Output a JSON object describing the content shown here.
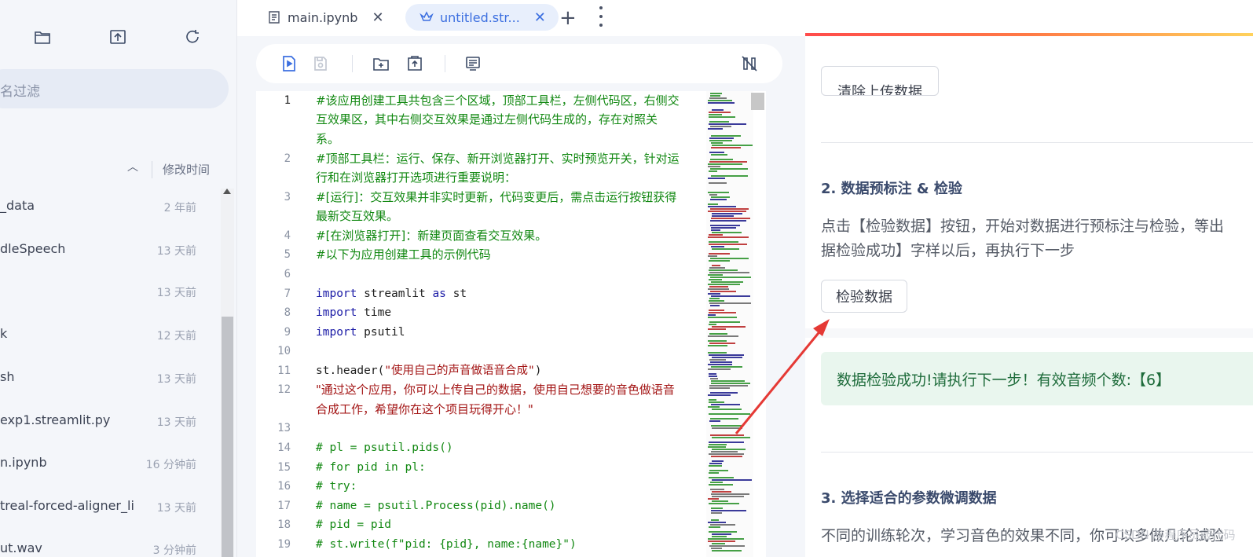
{
  "sidebar": {
    "tools": [
      "folder-icon",
      "upload-icon",
      "refresh-icon"
    ],
    "filter_placeholder": "名过滤",
    "column_modified": "修改时间",
    "files": [
      {
        "name": "_data",
        "time": "2 年前"
      },
      {
        "name": "dleSpeech",
        "time": "13 天前"
      },
      {
        "name": "",
        "time": "13 天前"
      },
      {
        "name": "k",
        "time": "12 天前"
      },
      {
        "name": "sh",
        "time": "13 天前"
      },
      {
        "name": "exp1.streamlit.py",
        "time": "13 天前"
      },
      {
        "name": "n.ipynb",
        "time": "16 分钟前"
      },
      {
        "name": "treal-forced-aligner_li",
        "time": "13 天前"
      },
      {
        "name": "ut.wav",
        "time": "3 分钟前"
      }
    ]
  },
  "tabs": [
    {
      "label": "main.ipynb",
      "close": "✕"
    },
    {
      "label": "untitled.str...",
      "close": "✕"
    }
  ],
  "tab_add": "+",
  "editor": {
    "line_numbers": [
      "1",
      "2",
      "3",
      "4",
      "5",
      "6",
      "7",
      "8",
      "9",
      "10",
      "11",
      "12",
      "13",
      "14",
      "15",
      "16",
      "17",
      "18",
      "19"
    ],
    "lines": [
      "#该应用创建工具共包含三个区域，顶部工具栏，左侧代码区，右侧交",
      "互效果区，其中右侧交互效果是通过左侧代码生成的，存在对照关",
      "系。",
      "#顶部工具栏：运行、保存、新开浏览器打开、实时预览开关，针对运",
      "行和在浏览器打开选项进行重要说明：",
      "#[运行]：交互效果并非实时更新，代码变更后，需点击运行按钮获得",
      "最新交互效果。",
      "#[在浏览器打开]：新建页面查看交互效果。",
      "#以下为应用创建工具的示例代码",
      "import",
      "streamlit",
      "as",
      "st",
      "time",
      "psutil",
      "st.header(",
      "\"使用自己的声音做语音合成\"",
      ")",
      "\"通过这个应用，你可以上传自己的数据，使用自己想要的音色做语音",
      "合成工作，希望你在这个项目玩得开心！\"",
      "# pl = psutil.pids()",
      "# for pid in pl:",
      "#     try:",
      "#         name = psutil.Process(pid).name()",
      "#         pid = pid",
      "#         st.write(f\"pid: {pid}, name:{name}\")"
    ]
  },
  "preview": {
    "clear_upload_button": "清除上传数据",
    "section2_title": "2. 数据预标注 & 检验",
    "section2_text_line1": "点击【检验数据】按钮，开始对数据进行预标注与检验，等出",
    "section2_text_line2": "据检验成功】字样以后，再执行下一步",
    "check_button": "检验数据",
    "success_message": "数据检验成功!请执行下一步！有效音频个数:【6】",
    "section3_title": "3. 选择适合的参数微调数据",
    "section3_text": "不同的训练轮次，学习音色的效果不同，你可以多做几轮试验",
    "watermark": "CSDN @程序员敲代码"
  },
  "colors": {
    "accent": "#3c6fe0",
    "arrow": "#e53935",
    "success_bg": "#e9f6ee",
    "success_text": "#1d6b3a"
  }
}
